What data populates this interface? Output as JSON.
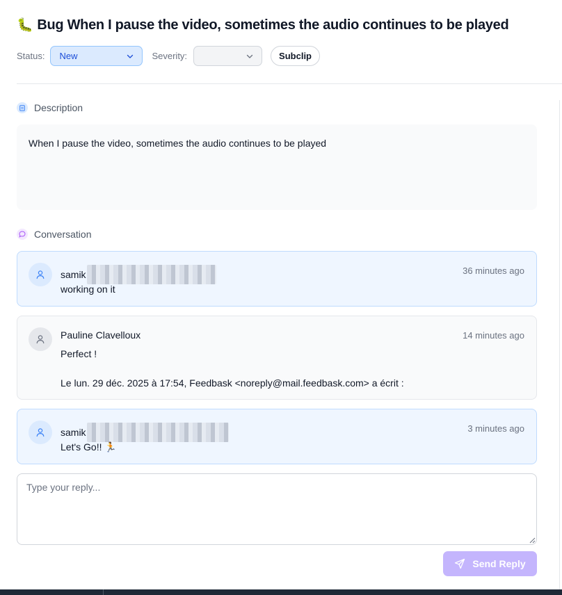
{
  "ticket": {
    "type_emoji": "🐛",
    "title": "Bug When I pause the video, sometimes the audio continues to be played"
  },
  "meta": {
    "status_label": "Status:",
    "status_value": "New",
    "severity_label": "Severity:",
    "severity_value": "",
    "subclip_label": "Subclip"
  },
  "description": {
    "heading": "Description",
    "text": "When I pause the video, sometimes the audio continues to be played"
  },
  "conversation": {
    "heading": "Conversation",
    "messages": [
      {
        "author": "samik",
        "author_redacted": true,
        "role": "team",
        "time": "36 minutes ago",
        "text": "working on it"
      },
      {
        "author": "Pauline Clavelloux",
        "author_redacted": false,
        "role": "client",
        "time": "14 minutes ago",
        "text": "Perfect !\n\nLe lun. 29 déc. 2025 à 17:54, Feedbask <noreply@mail.feedbask.com> a écrit :"
      },
      {
        "author": "samik",
        "author_redacted": true,
        "role": "team",
        "time": "3 minutes ago",
        "text": "Let's Go!! 🏃"
      }
    ]
  },
  "reply": {
    "placeholder": "Type your reply...",
    "value": "",
    "send_label": "Send Reply"
  },
  "icons": {
    "description": "document-icon",
    "conversation": "chat-bubble-icon",
    "avatar": "user-icon",
    "send": "paper-plane-icon"
  },
  "colors": {
    "status_bg": "#dbeafe",
    "status_text": "#1d4ed8",
    "team_bubble": "#eff6ff",
    "client_bubble": "#f9fafb",
    "send_button": "#c4b5fd"
  }
}
